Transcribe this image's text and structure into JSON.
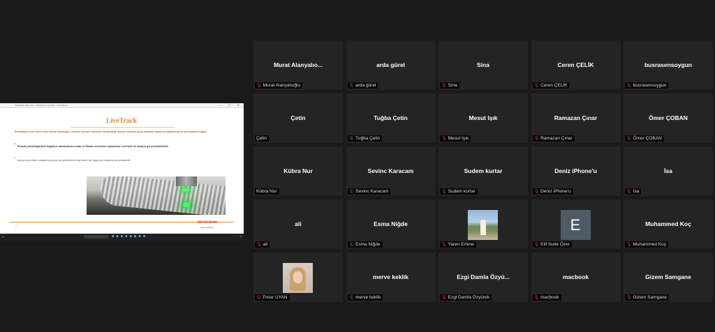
{
  "share": {
    "window_title": "Renishaw Wire Live – Renishaw LiveTrack · PowerPoint",
    "slide": {
      "title": "LiveTrack",
      "intro": "Renishaw'ın LiveTrack odak izleme teknolojisi, numune yüzeyini dinamik olarak takip ederek, kullanıcı girişi olmadan optimum odaklanmanın korunmasını sağlar.",
      "bullet1": "Pürüzlü yüksekliğindeki değişime bakılmaksızın odak içi Raman verilerinin toplanması LiveTrack ile kolayca gerçekleştirilebilir.",
      "bullet2": "Ayrıca numunelerin odaklanmış beyaz ışık görüntülerini elde etmek için beyaz ışık modunda da kullanılabilir.",
      "page": "4",
      "logo": "RENISHAW",
      "logo_sub": "apply innovation"
    }
  },
  "participants": [
    {
      "name": "Murat  Alanyalıo...",
      "label": "Murat Alanyalıoğlu",
      "muted": true
    },
    {
      "name": "arda gürel",
      "label": "arda gürel",
      "muted": true
    },
    {
      "name": "Sina",
      "label": "Sina",
      "muted": true
    },
    {
      "name": "Ceren ÇELİK",
      "label": "Ceren ÇELİK",
      "muted": true
    },
    {
      "name": "busrasensoygun",
      "label": "busrasensoygun",
      "muted": true
    },
    {
      "name": "Çetin",
      "label": "Çetin",
      "muted": false
    },
    {
      "name": "Tuğba Çetin",
      "label": "Tuğba Çetin",
      "muted": true
    },
    {
      "name": "Mesut Işık",
      "label": "Mesut Işık",
      "muted": true
    },
    {
      "name": "Ramazan Çınar",
      "label": "Ramazan Çınar",
      "muted": true
    },
    {
      "name": "Ömer ÇOBAN",
      "label": "Ömer ÇOBAN",
      "muted": true
    },
    {
      "name": "Kübra Nur",
      "label": "Kübra Nur",
      "muted": false
    },
    {
      "name": "Sevinc Karacam",
      "label": "Sevinc Karacam",
      "muted": true
    },
    {
      "name": "Sudem kurtar",
      "label": "Sudem kurtar",
      "muted": true
    },
    {
      "name": "Deniz iPhone'u",
      "label": "Deniz iPhone'u",
      "muted": true
    },
    {
      "name": "İsa",
      "label": "İsa",
      "muted": true
    },
    {
      "name": "ali",
      "label": "ali",
      "muted": true
    },
    {
      "name": "Esma Niğde",
      "label": "Esma Niğde",
      "muted": true
    },
    {
      "name": "",
      "label": "Yaren Emine",
      "muted": true,
      "photo": "yaren"
    },
    {
      "name": "",
      "label": "Elif Sude Özer",
      "muted": true,
      "avatar_letter": "E"
    },
    {
      "name": "Muhammed Koç",
      "label": "Muhammed Koç",
      "muted": true
    },
    {
      "name": "",
      "label": "Pınar UYAN",
      "muted": true,
      "photo": "pinar"
    },
    {
      "name": "merve keklik",
      "label": "merve keklik",
      "muted": true
    },
    {
      "name": "Ezgi Damla Özyü...",
      "label": "Ezgi Damla Özyürek",
      "muted": true
    },
    {
      "name": "macbook",
      "label": "macbook",
      "muted": true
    },
    {
      "name": "Gizem Samgane",
      "label": "Gizem Samgane",
      "muted": true
    }
  ],
  "colors": {
    "accent": "#e58a2c",
    "muted_mic": "#e02828",
    "tile_bg": "#242424"
  }
}
